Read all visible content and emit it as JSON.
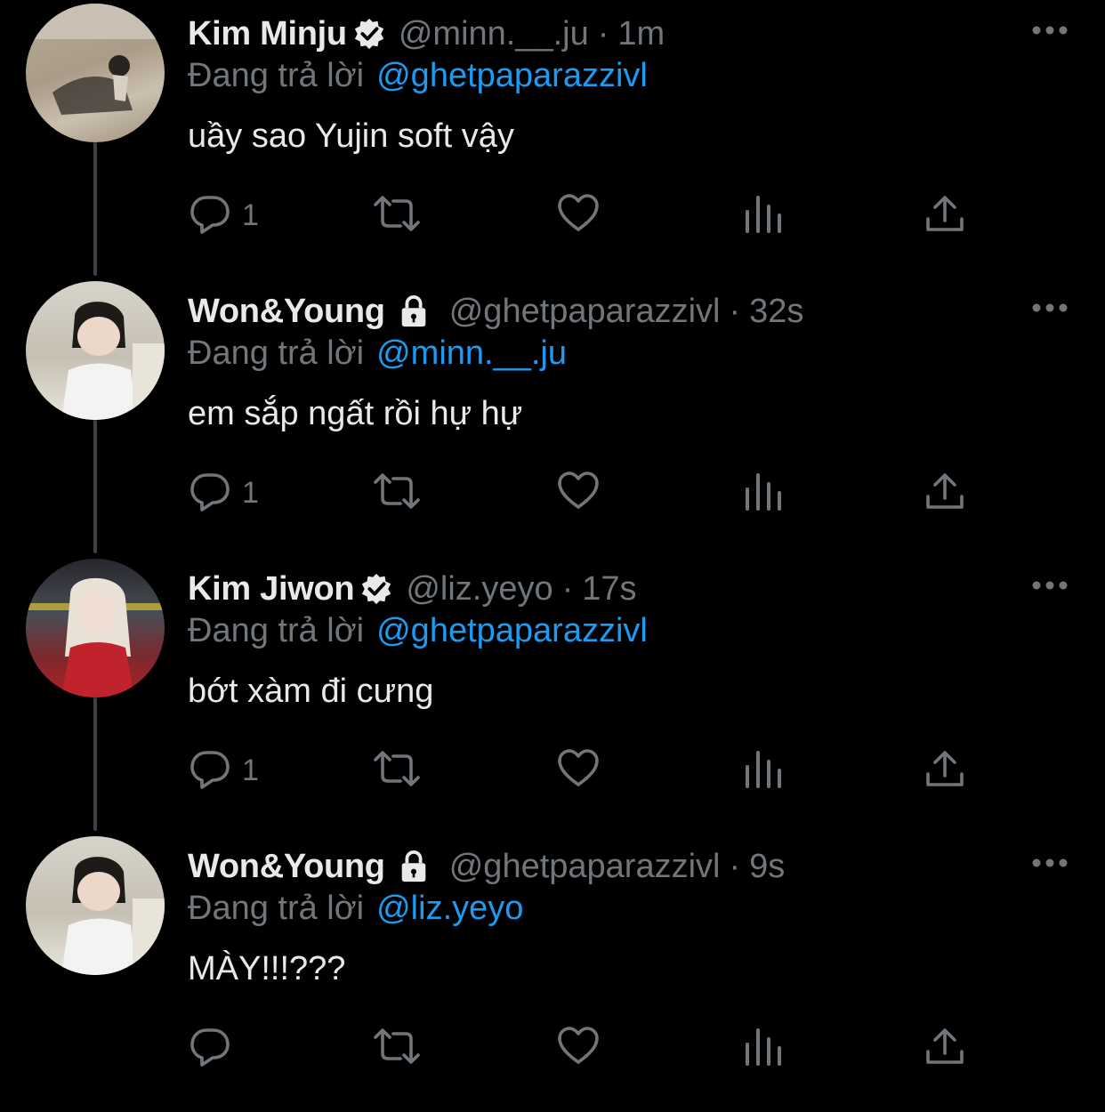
{
  "reply_prefix": "Đang trả lời",
  "tweets": [
    {
      "name": "Kim Minju",
      "badge": "verified",
      "handle": "@minn.__.ju",
      "time": "1m",
      "reply_to": "@ghetpaparazzivl",
      "text": "uầy sao Yujin soft vậy",
      "reply_count": "1",
      "avatar": "beach-photo"
    },
    {
      "name": "Won&Young",
      "badge": "protected",
      "handle": "@ghetpaparazzivl",
      "time": "32s",
      "reply_to": "@minn.__.ju",
      "text": "em sắp ngất rồi hự hự",
      "reply_count": "1",
      "avatar": "child-photo"
    },
    {
      "name": "Kim Jiwon",
      "badge": "verified",
      "handle": "@liz.yeyo",
      "time": "17s",
      "reply_to": "@ghetpaparazzivl",
      "text": "bớt xàm đi cưng",
      "reply_count": "1",
      "avatar": "stage-photo"
    },
    {
      "name": "Won&Young",
      "badge": "protected",
      "handle": "@ghetpaparazzivl",
      "time": "9s",
      "reply_to": "@liz.yeyo",
      "text": "MÀY!!!???",
      "reply_count": "",
      "avatar": "child-photo"
    }
  ],
  "separator": "·",
  "colors": {
    "background": "#000000",
    "primary_text": "#e7e9ea",
    "secondary_text": "#71767b",
    "mention": "#1d9bf0",
    "thread_line": "#3e4144"
  }
}
